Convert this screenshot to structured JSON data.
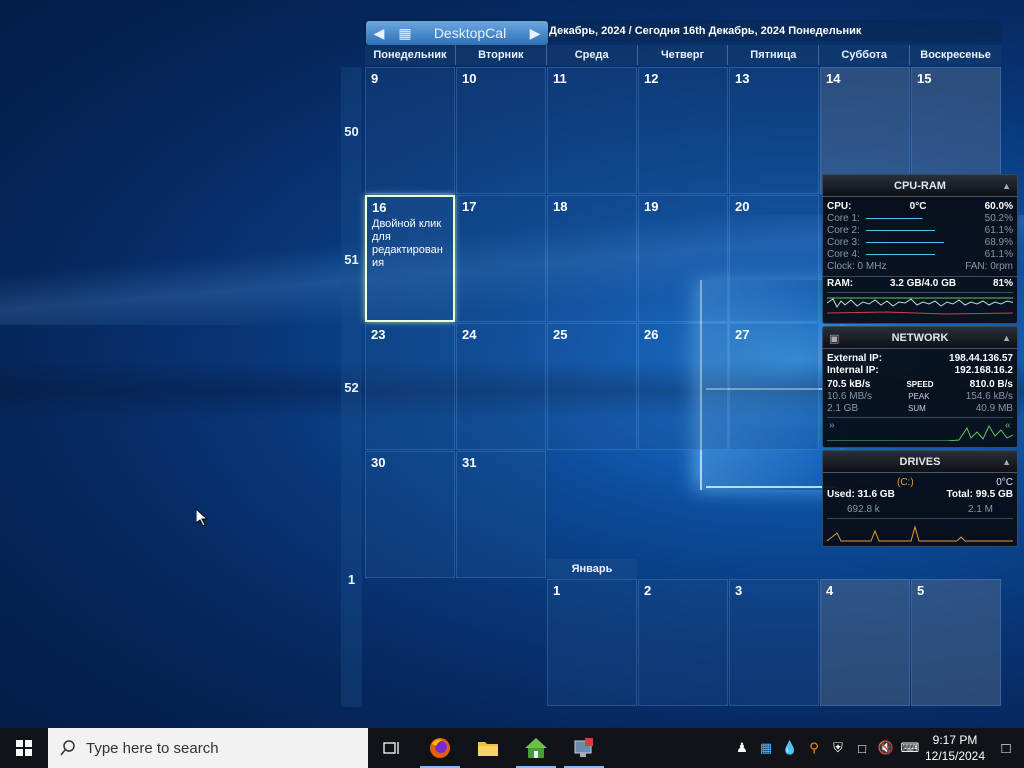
{
  "calendar": {
    "app_name": "DesktopCal",
    "title": "Декабрь, 2024 / Сегодня 16th Декабрь, 2024 Понедельник",
    "weekdays": [
      "Понедельник",
      "Вторник",
      "Среда",
      "Четверг",
      "Пятница",
      "Суббота",
      "Воскресенье"
    ],
    "weeks": [
      "50",
      "51",
      "52",
      "1"
    ],
    "days": {
      "d9": "9",
      "d10": "10",
      "d11": "11",
      "d12": "12",
      "d13": "13",
      "d14": "14",
      "d15": "15",
      "d16": "16",
      "d17": "17",
      "d18": "18",
      "d19": "19",
      "d20": "20",
      "d23": "23",
      "d24": "24",
      "d25": "25",
      "d26": "26",
      "d27": "27",
      "d30": "30",
      "d31": "31",
      "j1": "1",
      "j2": "2",
      "j3": "3",
      "j4": "4",
      "j5": "5"
    },
    "today_hint": "Двойной клик для редактирован ия",
    "next_month": "Январь"
  },
  "cpu_ram": {
    "title": "CPU-RAM",
    "cpu_label": "CPU:",
    "cpu_temp": "0°C",
    "cpu_pct": "60.0%",
    "cores": [
      {
        "label": "Core 1:",
        "value": "50.2%",
        "level": 0.5
      },
      {
        "label": "Core 2:",
        "value": "61.1%",
        "level": 0.61
      },
      {
        "label": "Core 3:",
        "value": "68.9%",
        "level": 0.69
      },
      {
        "label": "Core 4:",
        "value": "61.1%",
        "level": 0.61
      }
    ],
    "clock": "Clock: 0 MHz",
    "fan": "FAN: 0rpm",
    "ram_label": "RAM:",
    "ram_value": "3.2 GB/4.0 GB",
    "ram_pct": "81%"
  },
  "network": {
    "title": "NETWORK",
    "ext_label": "External IP:",
    "ext_ip": "198.44.136.57",
    "int_label": "Internal IP:",
    "int_ip": "192.168.16.2",
    "speed_down": "70.5 kB/s",
    "speed_label": "SPEED",
    "speed_up": "810.0 B/s",
    "peak_down": "10.6 MB/s",
    "peak_label": "PEAK",
    "peak_up": "154.6 kB/s",
    "sum_down": "2.1 GB",
    "sum_label": "SUM",
    "sum_up": "40.9 MB"
  },
  "drives": {
    "title": "DRIVES",
    "drive": "(C:)",
    "temp": "0°C",
    "used": "Used: 31.6 GB",
    "total": "Total: 99.5 GB",
    "read": "692.8 k",
    "write": "2.1 M"
  },
  "taskbar": {
    "search_placeholder": "Type here to search",
    "time": "9:17 PM",
    "date": "12/15/2024"
  }
}
